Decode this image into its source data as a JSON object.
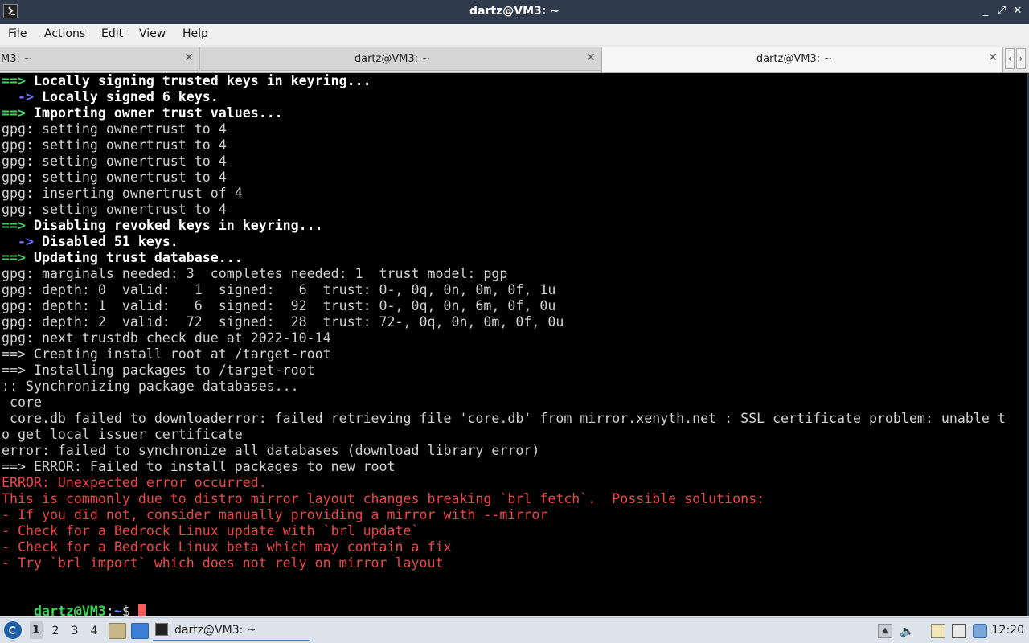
{
  "window": {
    "title": "dartz@VM3: ~"
  },
  "menu": [
    "File",
    "Actions",
    "Edit",
    "View",
    "Help"
  ],
  "tabs": [
    {
      "label": "M3: ~",
      "active": false
    },
    {
      "label": "dartz@VM3: ~",
      "active": false
    },
    {
      "label": "dartz@VM3: ~",
      "active": true
    }
  ],
  "terminal": {
    "lines": [
      {
        "style": "bold",
        "prefix": "==>",
        "prefix_style": "green",
        "text": " Locally signing trusted keys in keyring..."
      },
      {
        "style": "bold",
        "indent": "  ",
        "prefix": "->",
        "prefix_style": "blue",
        "text": " Locally signed 6 keys."
      },
      {
        "style": "bold",
        "prefix": "==>",
        "prefix_style": "green",
        "text": " Importing owner trust values..."
      },
      {
        "style": "normal",
        "text": "gpg: setting ownertrust to 4"
      },
      {
        "style": "normal",
        "text": "gpg: setting ownertrust to 4"
      },
      {
        "style": "normal",
        "text": "gpg: setting ownertrust to 4"
      },
      {
        "style": "normal",
        "text": "gpg: setting ownertrust to 4"
      },
      {
        "style": "normal",
        "text": "gpg: inserting ownertrust of 4"
      },
      {
        "style": "normal",
        "text": "gpg: setting ownertrust to 4"
      },
      {
        "style": "bold",
        "prefix": "==>",
        "prefix_style": "green",
        "text": " Disabling revoked keys in keyring..."
      },
      {
        "style": "bold",
        "indent": "  ",
        "prefix": "->",
        "prefix_style": "blue",
        "text": " Disabled 51 keys."
      },
      {
        "style": "bold",
        "prefix": "==>",
        "prefix_style": "green",
        "text": " Updating trust database..."
      },
      {
        "style": "normal",
        "text": "gpg: marginals needed: 3  completes needed: 1  trust model: pgp"
      },
      {
        "style": "normal",
        "text": "gpg: depth: 0  valid:   1  signed:   6  trust: 0-, 0q, 0n, 0m, 0f, 1u"
      },
      {
        "style": "normal",
        "text": "gpg: depth: 1  valid:   6  signed:  92  trust: 0-, 0q, 0n, 6m, 0f, 0u"
      },
      {
        "style": "normal",
        "text": "gpg: depth: 2  valid:  72  signed:  28  trust: 72-, 0q, 0n, 0m, 0f, 0u"
      },
      {
        "style": "normal",
        "text": "gpg: next trustdb check due at 2022-10-14"
      },
      {
        "style": "normal",
        "text": "==> Creating install root at /target-root"
      },
      {
        "style": "normal",
        "text": "==> Installing packages to /target-root"
      },
      {
        "style": "normal",
        "text": ":: Synchronizing package databases..."
      },
      {
        "style": "normal",
        "text": " core"
      },
      {
        "style": "normal",
        "text": " core.db failed to downloaderror: failed retrieving file 'core.db' from mirror.xenyth.net : SSL certificate problem: unable t"
      },
      {
        "style": "normal",
        "text": "o get local issuer certificate"
      },
      {
        "style": "normal",
        "text": "error: failed to synchronize all databases (download library error)"
      },
      {
        "style": "normal",
        "text": "==> ERROR: Failed to install packages to new root"
      },
      {
        "style": "err",
        "text": "ERROR: Unexpected error occurred."
      },
      {
        "style": "err",
        "text": "This is commonly due to distro mirror layout changes breaking `brl fetch`.  Possible solutions:"
      },
      {
        "style": "err",
        "text": "- If you did not, consider manually providing a mirror with --mirror"
      },
      {
        "style": "err",
        "text": "- Check for a Bedrock Linux update with `brl update`"
      },
      {
        "style": "err",
        "text": "- Check for a Bedrock Linux beta which may contain a fix"
      },
      {
        "style": "err",
        "text": "- Try `brl import` which does not rely on mirror layout"
      }
    ],
    "prompt": {
      "user": "dartz@VM3",
      "sep": ":",
      "path": "~",
      "symbol": "$ "
    }
  },
  "taskbar": {
    "workspaces": [
      "1",
      "2",
      "3",
      "4"
    ],
    "active_workspace": "1",
    "task_label": "dartz@VM3: ~",
    "clock": "12:20"
  },
  "icons": {
    "app": "terminal-icon",
    "start": "start-menu-icon",
    "file_manager": "file-manager-icon",
    "desktop": "show-desktop-icon",
    "volume": "volume-icon",
    "clipboard": "clipboard-icon",
    "keyboard": "keyboard-icon",
    "network": "network-icon",
    "tray_arrow": "tray-arrow-icon"
  }
}
